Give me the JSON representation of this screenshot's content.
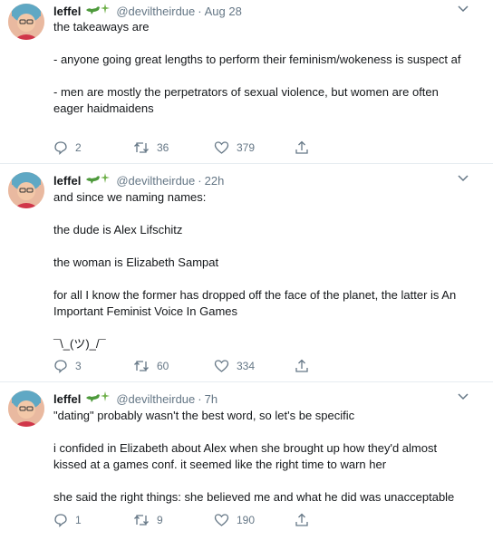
{
  "tweets": [
    {
      "name": "leffel",
      "handle": "@deviltheirdue",
      "time": "Aug 28",
      "paragraphs": [
        "the takeaways are",
        "- anyone going great lengths to perform their feminism/wokeness is suspect af",
        "- men are mostly the perpetrators of sexual violence, but women are often eager haidmaidens"
      ],
      "replies": "2",
      "retweets": "36",
      "likes": "379"
    },
    {
      "name": "leffel",
      "handle": "@deviltheirdue",
      "time": "22h",
      "paragraphs": [
        "and since we naming names:",
        "the dude is Alex Lifschitz",
        "the woman is Elizabeth Sampat",
        "for all I know the former has dropped off the face of the planet, the latter is An Important Feminist Voice In Games",
        "¯\\_(ツ)_/¯"
      ],
      "replies": "3",
      "retweets": "60",
      "likes": "334"
    },
    {
      "name": "leffel",
      "handle": "@deviltheirdue",
      "time": "7h",
      "paragraphs": [
        "\"dating\" probably wasn't the best word, so let's be specific",
        "i confided in Elizabeth about Alex when she brought up how they'd almost kissed at a games conf. it seemed like the right time to warn her",
        "she said the right things: she believed me and what he did was unacceptable"
      ],
      "replies": "1",
      "retweets": "9",
      "likes": "190"
    }
  ],
  "colors": {
    "text": "#14171a",
    "muted": "#657786",
    "divider": "#e6ecf0"
  },
  "icons": [
    "reply-icon",
    "retweet-icon",
    "like-icon",
    "share-icon",
    "chevron-down-icon",
    "dinosaur-emoji",
    "sparkle-emoji"
  ]
}
